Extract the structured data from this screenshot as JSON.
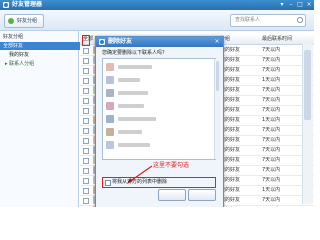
{
  "titlebar": {
    "title": "好友管理器",
    "buttons": [
      "▾",
      "–",
      "□",
      "×"
    ]
  },
  "toolbar": {
    "add_friend_label": "好友分组",
    "search_placeholder": "查找联系人"
  },
  "sidebar": {
    "header": "好友分组",
    "items": [
      {
        "label": "全部好友",
        "selected": true
      },
      {
        "label": "我的好友",
        "selected": false
      },
      {
        "label": "▸ 联系人分组",
        "selected": false
      }
    ]
  },
  "table": {
    "headers": [
      "全部",
      "分组",
      "最后联系时间"
    ],
    "rows": [
      {
        "group": "我的好友",
        "last": "7天以内"
      },
      {
        "group": "我的好友",
        "last": "7天以内"
      },
      {
        "group": "我的好友",
        "last": "7天以内"
      },
      {
        "group": "我的好友",
        "last": "1天以内"
      },
      {
        "group": "我的好友",
        "last": "7天以内"
      },
      {
        "group": "我的好友",
        "last": "7天以内"
      },
      {
        "group": "我的好友",
        "last": "7天以内"
      },
      {
        "group": "我的好友",
        "last": "1天以内"
      },
      {
        "group": "我的好友",
        "last": "7天以内"
      },
      {
        "group": "我的好友",
        "last": "7天以内"
      },
      {
        "group": "我的好友",
        "last": "7天以内"
      },
      {
        "group": "我的好友",
        "last": "7天以内"
      },
      {
        "group": "我的好友",
        "last": "7天以内"
      },
      {
        "group": "我的好友",
        "last": "7天以内"
      },
      {
        "group": "我的好友",
        "last": "1天以内"
      },
      {
        "group": "我的好友",
        "last": "7天以内"
      },
      {
        "group": "我的好友",
        "last": "7天以内"
      }
    ]
  },
  "dialog": {
    "title": "删除好友",
    "prompt": "您确定要删除以下联系人吗？",
    "list_avatar_colors": [
      "#e5b9b0",
      "#b7c3d6",
      "#a8b4c4",
      "#d9a7b9",
      "#9cb3c9",
      "#c6b19d",
      "#b9c8d8"
    ],
    "checkbox_label": "将我从对方的列表中删除",
    "annotation": "这里不要勾选",
    "close_symbol": "×"
  },
  "colors": {
    "accent": "#3a84d1",
    "annotation": "#e02020"
  }
}
